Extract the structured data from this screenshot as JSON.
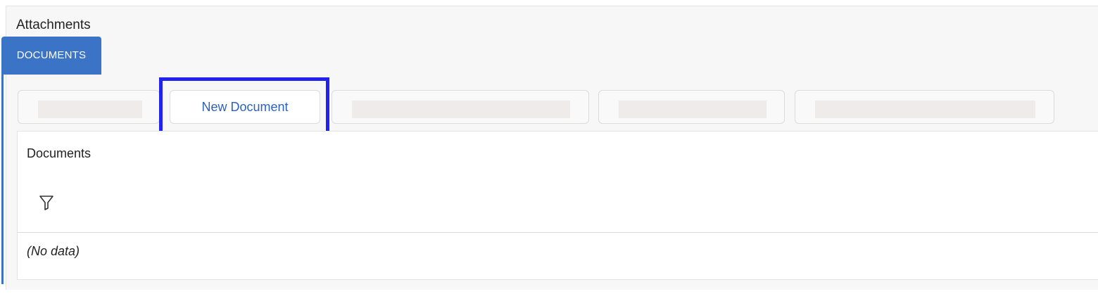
{
  "panel": {
    "title": "Attachments"
  },
  "tabs": [
    {
      "label": "DOCUMENTS",
      "active": true
    }
  ],
  "toolbar": {
    "new_document_label": "New Document",
    "highlighted": "New Document",
    "highlight_color": "#2222ee"
  },
  "grid": {
    "title": "Documents",
    "filter_icon": "filter-funnel-icon",
    "empty_text": "(No data)"
  },
  "colors": {
    "accent": "#3b73c7",
    "button_text": "#2e62b8"
  }
}
